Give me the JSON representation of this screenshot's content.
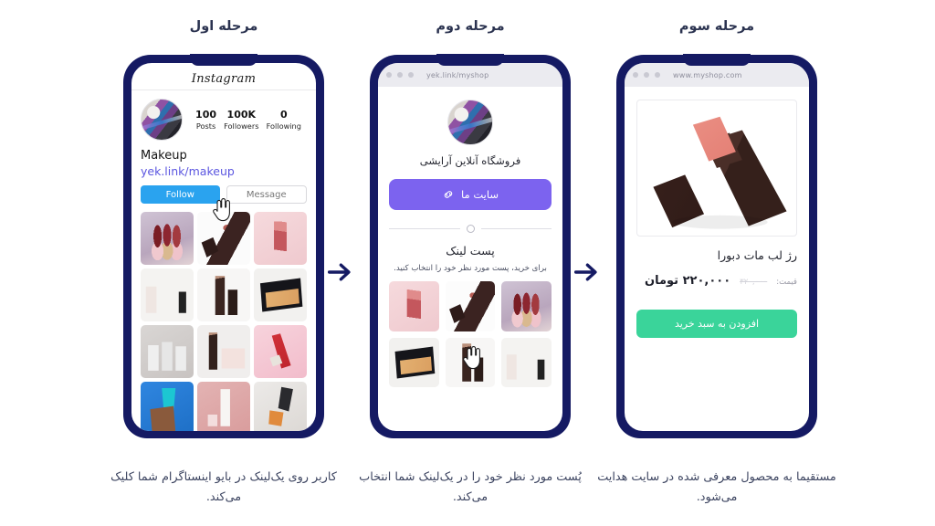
{
  "steps": [
    {
      "title": "مرحله اول",
      "caption": "کاربر روی یک‌لینک در بایو اینستاگرام شما کلیک می‌کند."
    },
    {
      "title": "مرحله دوم",
      "caption": "پُست مورد نظر خود را در یک‌لینک شما انتخاب می‌کند."
    },
    {
      "title": "مرحله سوم",
      "caption": "مستقیما به محصول معرفی شده در سایت هدایت می‌شود."
    }
  ],
  "instagram": {
    "logo": "Instagram",
    "stats": [
      {
        "num": "100",
        "label": "Posts"
      },
      {
        "num": "100K",
        "label": "Followers"
      },
      {
        "num": "0",
        "label": "Following"
      }
    ],
    "account_name": "Makeup",
    "bio_link": "yek.link/makeup",
    "follow_label": "Follow",
    "message_label": "Message",
    "cursor_icon": "pointing-hand-cursor",
    "avatar_icon": "makeup-brushes-avatar"
  },
  "yeklink": {
    "browser_url": "yek.link/myshop",
    "shop_name": "فروشگاه آنلاین آرایشی",
    "site_button_label": "سایت ما",
    "site_button_icon": "chain-link-icon",
    "post_section_title": "پست لینک",
    "post_section_subtitle": "برای خرید، پست مورد نظر خود را انتخاب کنید.",
    "cursor_icon": "pointing-hand-cursor",
    "divider_icon": "circle-divider"
  },
  "shop": {
    "browser_url": "www.myshop.com",
    "product_image_alt": "lipstick-product-photo",
    "product_name": "رژ لب مات دبورا",
    "price_label": "قیمت:",
    "price_old": "۳۲۰,۰۰۰",
    "price_new": "۲۲۰,۰۰۰ تومان",
    "cart_button_label": "افزودن به سبد خرید"
  },
  "arrows": {
    "icon": "arrow-right-icon",
    "count": 2
  },
  "colors": {
    "phone_frame": "#151a63",
    "instagram_follow": "#2aa3ef",
    "bio_link": "#5b56e0",
    "site_button": "#7c63ef",
    "cart_button": "#3ad49a",
    "title_text": "#2b3350",
    "background": "#ffffff"
  }
}
